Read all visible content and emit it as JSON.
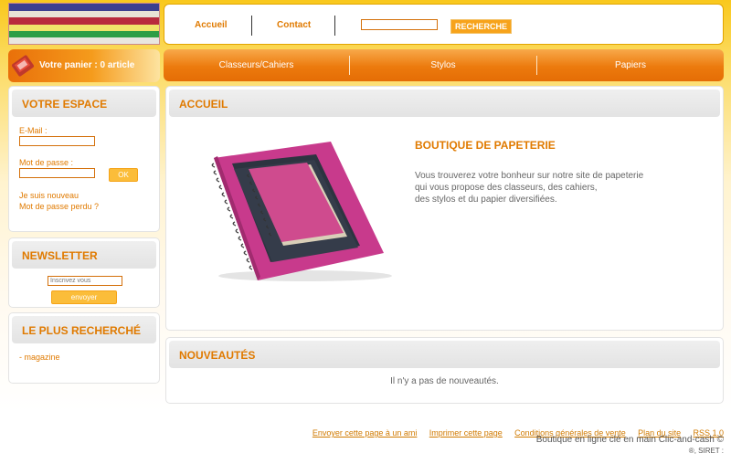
{
  "header": {
    "nav": [
      {
        "label": "Accueil"
      },
      {
        "label": "Contact"
      }
    ],
    "search": {
      "value": "",
      "button": "RECHERCHE"
    }
  },
  "cart": {
    "label": "Votre panier : 0 article"
  },
  "menu": [
    {
      "label": "Classeurs/Cahiers"
    },
    {
      "label": "Stylos"
    },
    {
      "label": "Papiers"
    }
  ],
  "sidebar": {
    "account": {
      "title": "VOTRE ESPACE",
      "email_label": "E-Mail :",
      "password_label": "Mot de passe :",
      "ok_label": "OK",
      "new_user": "Je suis nouveau",
      "lost_password": "Mot de passe perdu ?"
    },
    "newsletter": {
      "title": "NEWSLETTER",
      "placeholder": "Inscrivez vous",
      "button": "envoyer"
    },
    "popular": {
      "title": "LE PLUS RECHERCHÉ",
      "items": [
        "- magazine"
      ]
    }
  },
  "main": {
    "home": {
      "title": "ACCUEIL",
      "heading": "BOUTIQUE DE PAPETERIE",
      "lines": [
        "Vous trouverez votre bonheur sur notre site de papeterie",
        "qui vous propose des classeurs, des cahiers,",
        "des stylos et du papier diversifiées."
      ]
    },
    "new": {
      "title": "NOUVEAUTÉS",
      "empty": "Il n'y a pas de nouveautés."
    }
  },
  "footer": {
    "links": [
      "Envoyer cette page à un ami",
      "Imprimer cette page",
      "Conditions générales de vente",
      "Plan du site",
      "RSS 1.0"
    ],
    "credit": "Boutique en ligne clé en main Clic-and-cash ©",
    "siret": "®, SIRET :"
  },
  "colors": {
    "accent": "#e07a00",
    "menu": "#ec7a0d",
    "background": "#f9c81c"
  }
}
